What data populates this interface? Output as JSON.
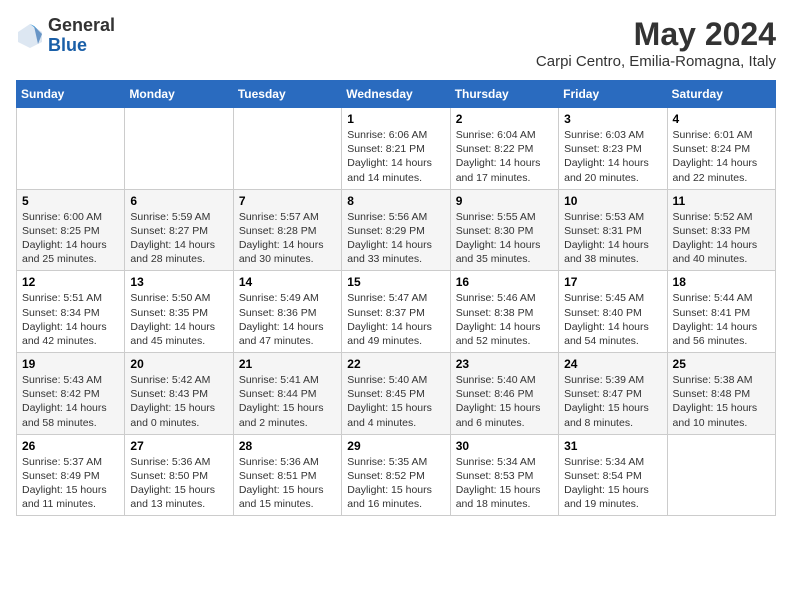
{
  "logo": {
    "general": "General",
    "blue": "Blue"
  },
  "header": {
    "month_title": "May 2024",
    "subtitle": "Carpi Centro, Emilia-Romagna, Italy"
  },
  "weekdays": [
    "Sunday",
    "Monday",
    "Tuesday",
    "Wednesday",
    "Thursday",
    "Friday",
    "Saturday"
  ],
  "weeks": [
    [
      {
        "day": "",
        "content": ""
      },
      {
        "day": "",
        "content": ""
      },
      {
        "day": "",
        "content": ""
      },
      {
        "day": "1",
        "content": "Sunrise: 6:06 AM\nSunset: 8:21 PM\nDaylight: 14 hours\nand 14 minutes."
      },
      {
        "day": "2",
        "content": "Sunrise: 6:04 AM\nSunset: 8:22 PM\nDaylight: 14 hours\nand 17 minutes."
      },
      {
        "day": "3",
        "content": "Sunrise: 6:03 AM\nSunset: 8:23 PM\nDaylight: 14 hours\nand 20 minutes."
      },
      {
        "day": "4",
        "content": "Sunrise: 6:01 AM\nSunset: 8:24 PM\nDaylight: 14 hours\nand 22 minutes."
      }
    ],
    [
      {
        "day": "5",
        "content": "Sunrise: 6:00 AM\nSunset: 8:25 PM\nDaylight: 14 hours\nand 25 minutes."
      },
      {
        "day": "6",
        "content": "Sunrise: 5:59 AM\nSunset: 8:27 PM\nDaylight: 14 hours\nand 28 minutes."
      },
      {
        "day": "7",
        "content": "Sunrise: 5:57 AM\nSunset: 8:28 PM\nDaylight: 14 hours\nand 30 minutes."
      },
      {
        "day": "8",
        "content": "Sunrise: 5:56 AM\nSunset: 8:29 PM\nDaylight: 14 hours\nand 33 minutes."
      },
      {
        "day": "9",
        "content": "Sunrise: 5:55 AM\nSunset: 8:30 PM\nDaylight: 14 hours\nand 35 minutes."
      },
      {
        "day": "10",
        "content": "Sunrise: 5:53 AM\nSunset: 8:31 PM\nDaylight: 14 hours\nand 38 minutes."
      },
      {
        "day": "11",
        "content": "Sunrise: 5:52 AM\nSunset: 8:33 PM\nDaylight: 14 hours\nand 40 minutes."
      }
    ],
    [
      {
        "day": "12",
        "content": "Sunrise: 5:51 AM\nSunset: 8:34 PM\nDaylight: 14 hours\nand 42 minutes."
      },
      {
        "day": "13",
        "content": "Sunrise: 5:50 AM\nSunset: 8:35 PM\nDaylight: 14 hours\nand 45 minutes."
      },
      {
        "day": "14",
        "content": "Sunrise: 5:49 AM\nSunset: 8:36 PM\nDaylight: 14 hours\nand 47 minutes."
      },
      {
        "day": "15",
        "content": "Sunrise: 5:47 AM\nSunset: 8:37 PM\nDaylight: 14 hours\nand 49 minutes."
      },
      {
        "day": "16",
        "content": "Sunrise: 5:46 AM\nSunset: 8:38 PM\nDaylight: 14 hours\nand 52 minutes."
      },
      {
        "day": "17",
        "content": "Sunrise: 5:45 AM\nSunset: 8:40 PM\nDaylight: 14 hours\nand 54 minutes."
      },
      {
        "day": "18",
        "content": "Sunrise: 5:44 AM\nSunset: 8:41 PM\nDaylight: 14 hours\nand 56 minutes."
      }
    ],
    [
      {
        "day": "19",
        "content": "Sunrise: 5:43 AM\nSunset: 8:42 PM\nDaylight: 14 hours\nand 58 minutes."
      },
      {
        "day": "20",
        "content": "Sunrise: 5:42 AM\nSunset: 8:43 PM\nDaylight: 15 hours\nand 0 minutes."
      },
      {
        "day": "21",
        "content": "Sunrise: 5:41 AM\nSunset: 8:44 PM\nDaylight: 15 hours\nand 2 minutes."
      },
      {
        "day": "22",
        "content": "Sunrise: 5:40 AM\nSunset: 8:45 PM\nDaylight: 15 hours\nand 4 minutes."
      },
      {
        "day": "23",
        "content": "Sunrise: 5:40 AM\nSunset: 8:46 PM\nDaylight: 15 hours\nand 6 minutes."
      },
      {
        "day": "24",
        "content": "Sunrise: 5:39 AM\nSunset: 8:47 PM\nDaylight: 15 hours\nand 8 minutes."
      },
      {
        "day": "25",
        "content": "Sunrise: 5:38 AM\nSunset: 8:48 PM\nDaylight: 15 hours\nand 10 minutes."
      }
    ],
    [
      {
        "day": "26",
        "content": "Sunrise: 5:37 AM\nSunset: 8:49 PM\nDaylight: 15 hours\nand 11 minutes."
      },
      {
        "day": "27",
        "content": "Sunrise: 5:36 AM\nSunset: 8:50 PM\nDaylight: 15 hours\nand 13 minutes."
      },
      {
        "day": "28",
        "content": "Sunrise: 5:36 AM\nSunset: 8:51 PM\nDaylight: 15 hours\nand 15 minutes."
      },
      {
        "day": "29",
        "content": "Sunrise: 5:35 AM\nSunset: 8:52 PM\nDaylight: 15 hours\nand 16 minutes."
      },
      {
        "day": "30",
        "content": "Sunrise: 5:34 AM\nSunset: 8:53 PM\nDaylight: 15 hours\nand 18 minutes."
      },
      {
        "day": "31",
        "content": "Sunrise: 5:34 AM\nSunset: 8:54 PM\nDaylight: 15 hours\nand 19 minutes."
      },
      {
        "day": "",
        "content": ""
      }
    ]
  ]
}
